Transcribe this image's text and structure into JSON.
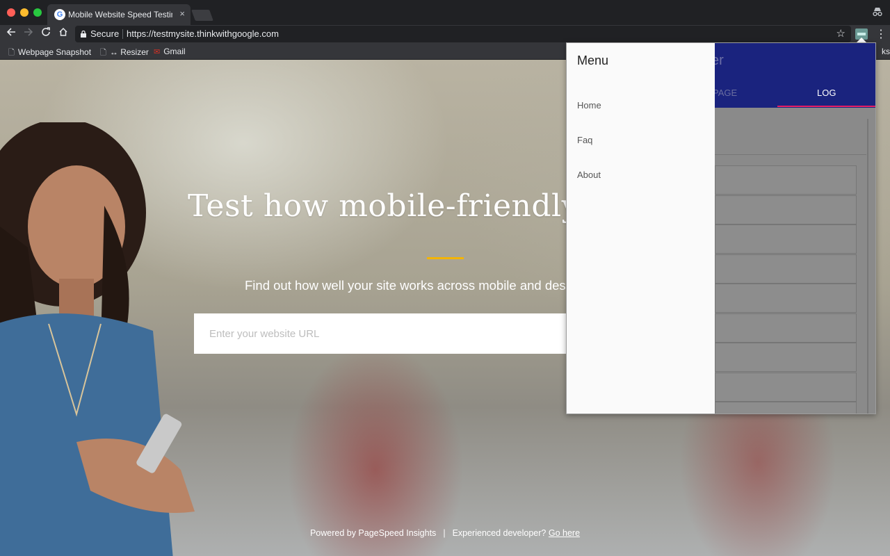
{
  "browser": {
    "tab_title": "Mobile Website Speed Testing",
    "tab_close": "×",
    "address": {
      "secure_label": "Secure",
      "url": "https://testmysite.thinkwithgoogle.com"
    },
    "bookmarks": [
      {
        "label": "Webpage Snapshot"
      },
      {
        "label": "↔ Resizer"
      },
      {
        "label": "Gmail"
      }
    ],
    "bookmarks_right": "ks"
  },
  "page": {
    "hero_title": "Test how mobile-friendly yo",
    "hero_subtitle": "Find out how well your site works across mobile and des",
    "url_input_placeholder": "Enter your website URL",
    "footer": {
      "powered_by": "Powered by PageSpeed Insights",
      "separator": "|",
      "developer_prompt": "Experienced developer?",
      "developer_link": "Go here"
    }
  },
  "extension_popup": {
    "header_title_partial": "er",
    "tabs": [
      {
        "label": "PAGE"
      },
      {
        "label": "LOG",
        "active": true
      }
    ],
    "drawer": {
      "title": "Menu",
      "items": [
        {
          "label": "Home"
        },
        {
          "label": "Faq"
        },
        {
          "label": "About"
        }
      ]
    }
  },
  "colors": {
    "accent_rule": "#f4b400",
    "popup_header": "#1a237e",
    "tab_indicator": "#e91e63"
  },
  "icons": [
    "back-icon",
    "forward-icon",
    "reload-icon",
    "home-icon",
    "lock-icon",
    "star-icon",
    "extension-icon",
    "menu-icon",
    "incognito-icon",
    "page-icon",
    "gmail-icon",
    "google-favicon"
  ]
}
